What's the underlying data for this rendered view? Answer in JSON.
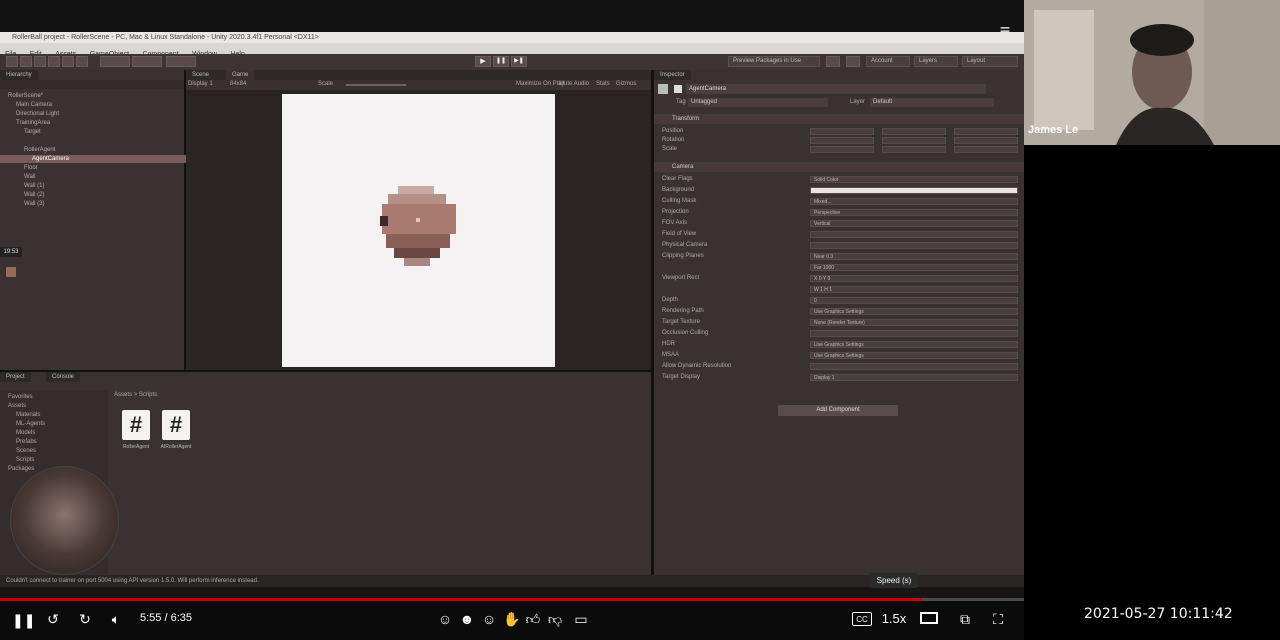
{
  "participant": {
    "name": "James Le"
  },
  "unity": {
    "title": "RollerBall project - RollerScene - PC, Mac & Linux Standalone - Unity 2020.3.4f1 Personal <DX11>",
    "menu": [
      "File",
      "Edit",
      "Assets",
      "GameObject",
      "Component",
      "Window",
      "Help"
    ],
    "toolbar": {
      "play": "▶",
      "pause": "❚❚",
      "step": "▶❚",
      "packages": "Preview Packages in Use",
      "account": "Account",
      "layers": "Layers",
      "layout": "Layout"
    },
    "hierarchy": {
      "tab": "Hierarchy",
      "rows": [
        {
          "label": "RollerScene*",
          "sel": false,
          "indent": 0
        },
        {
          "label": "Main Camera",
          "sel": false,
          "indent": 1
        },
        {
          "label": "Directional Light",
          "sel": false,
          "indent": 1
        },
        {
          "label": "TrainingArea",
          "sel": false,
          "indent": 1
        },
        {
          "label": "Target",
          "sel": false,
          "indent": 2
        },
        {
          "label": "",
          "sel": false,
          "indent": 2
        },
        {
          "label": "RollerAgent",
          "sel": false,
          "indent": 2
        },
        {
          "label": "AgentCamera",
          "sel": true,
          "indent": 3
        },
        {
          "label": "Floor",
          "sel": false,
          "indent": 2
        },
        {
          "label": "Wall",
          "sel": false,
          "indent": 2
        },
        {
          "label": "Wall (1)",
          "sel": false,
          "indent": 2
        },
        {
          "label": "Wall (2)",
          "sel": false,
          "indent": 2
        },
        {
          "label": "Wall (3)",
          "sel": false,
          "indent": 2
        }
      ]
    },
    "game": {
      "tabs": [
        "Scene",
        "Game"
      ],
      "display": "Display 1",
      "aspect": "84x84",
      "scale_label": "Scale",
      "maximize": "Maximize On Play",
      "mute": "Mute Audio",
      "stats": "Stats",
      "gizmos": "Gizmos"
    },
    "inspector": {
      "tab": "Inspector",
      "object": "AgentCamera",
      "tag": "Untagged",
      "layer": "Default",
      "transform_header": "Transform",
      "transform_rows": [
        "Position",
        "Rotation",
        "Scale"
      ],
      "camera_header": "Camera",
      "camera_rows": [
        "Clear Flags",
        "Background",
        "Culling Mask",
        "Projection",
        "FOV Axis",
        "Field of View",
        "Physical Camera",
        "Clipping Planes",
        "",
        "Viewport Rect",
        "",
        "Depth",
        "Rendering Path",
        "Target Texture",
        "Occlusion Culling",
        "HDR",
        "MSAA",
        "Allow Dynamic Resolution",
        "Target Display"
      ],
      "camera_values": [
        "Solid Color",
        "",
        "Mixed...",
        "Perspective",
        "Vertical",
        "",
        "",
        "Near 0.3",
        "Far 1000",
        "X 0  Y 0",
        "W 1  H 1",
        "0",
        "Use Graphics Settings",
        "None (Render Texture)",
        "",
        "Use Graphics Settings",
        "Use Graphics Settings",
        "",
        "Display 1"
      ],
      "add_component": "Add Component"
    },
    "project": {
      "tabs": [
        "Project",
        "Console"
      ],
      "tree": [
        "Favorites",
        "Assets",
        "Materials",
        "ML-Agents",
        "Models",
        "Prefabs",
        "Scenes",
        "Scripts",
        "Packages"
      ],
      "breadcrumb": "Assets > Scripts",
      "scripts": [
        "RollerAgent",
        "AIRollerAgent"
      ]
    },
    "status": "Couldn't connect to trainer on port 5004 using API version 1.5.0. Will perform inference instead."
  },
  "presenter": {
    "time": "19:53"
  },
  "player": {
    "time": "5:55 / 6:35",
    "speed": "1.5x",
    "speed_tooltip": "Speed (s)",
    "progress": 0.899,
    "cc": "CC",
    "play_state_icon": "pause-icon"
  },
  "timestamp": "2021-05-27 10:11:42",
  "colors": {
    "progress": "#cc0000",
    "selection": "#7b5a5a"
  }
}
